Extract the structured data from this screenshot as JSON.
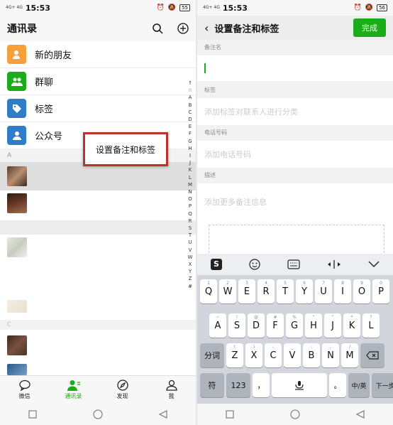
{
  "left": {
    "status": {
      "signal": "4G+\n4G",
      "time": "15:53",
      "battery": "55"
    },
    "header": {
      "title": "通讯录"
    },
    "contacts_special": [
      {
        "label": "新的朋友",
        "color": "#f5a038",
        "icon": "person-add-icon"
      },
      {
        "label": "群聊",
        "color": "#1aad19",
        "icon": "group-icon"
      },
      {
        "label": "标签",
        "color": "#2f7cc9",
        "icon": "tag-icon"
      },
      {
        "label": "公众号",
        "color": "#2f7cc9",
        "icon": "person-icon"
      }
    ],
    "section_a": "A",
    "section_c": "C",
    "index_letters": [
      "↑",
      "☆",
      "A",
      "B",
      "C",
      "D",
      "E",
      "F",
      "G",
      "H",
      "I",
      "J",
      "K",
      "L",
      "M",
      "N",
      "O",
      "P",
      "Q",
      "R",
      "S",
      "T",
      "U",
      "V",
      "W",
      "X",
      "Y",
      "Z",
      "#"
    ],
    "popup": {
      "label": "设置备注和标签"
    },
    "tabs": [
      {
        "label": "微信",
        "icon": "chat-icon"
      },
      {
        "label": "通讯录",
        "icon": "contacts-icon"
      },
      {
        "label": "发现",
        "icon": "compass-icon"
      },
      {
        "label": "我",
        "icon": "me-icon"
      }
    ]
  },
  "right": {
    "status": {
      "signal": "4G+\n4G",
      "time": "15:53",
      "battery": "56"
    },
    "header": {
      "title": "设置备注和标签",
      "done": "完成"
    },
    "fields": [
      {
        "label": "备注名",
        "placeholder": ""
      },
      {
        "label": "标签",
        "placeholder": "添加标签对联系人进行分类"
      },
      {
        "label": "电话号码",
        "placeholder": "添加电话号码"
      },
      {
        "label": "描述",
        "placeholder": "添加更多备注信息"
      }
    ],
    "keyboard": {
      "row1": [
        {
          "k": "Q",
          "s": "1"
        },
        {
          "k": "W",
          "s": "2"
        },
        {
          "k": "E",
          "s": "3"
        },
        {
          "k": "R",
          "s": "4"
        },
        {
          "k": "T",
          "s": "5"
        },
        {
          "k": "Y",
          "s": "6"
        },
        {
          "k": "U",
          "s": "7"
        },
        {
          "k": "I",
          "s": "8"
        },
        {
          "k": "O",
          "s": "9"
        },
        {
          "k": "P",
          "s": "0"
        }
      ],
      "row2": [
        {
          "k": "A",
          "s": "~"
        },
        {
          "k": "S",
          "s": "!"
        },
        {
          "k": "D",
          "s": "@"
        },
        {
          "k": "F",
          "s": "#"
        },
        {
          "k": "G",
          "s": "%"
        },
        {
          "k": "H",
          "s": "\""
        },
        {
          "k": "J",
          "s": "\""
        },
        {
          "k": "K",
          "s": "*"
        },
        {
          "k": "L",
          "s": "?"
        }
      ],
      "row3": [
        {
          "k": "Z",
          "s": "("
        },
        {
          "k": "X",
          "s": ")"
        },
        {
          "k": "C",
          "s": "-"
        },
        {
          "k": "V",
          "s": "_"
        },
        {
          "k": "B",
          "s": ":"
        },
        {
          "k": "N",
          "s": ";"
        },
        {
          "k": "M",
          "s": "/"
        }
      ],
      "fenci": "分词",
      "fu": "符",
      "num": "123",
      "comma": "，",
      "period": "。",
      "lang": "中/英",
      "next": "下一步"
    }
  }
}
